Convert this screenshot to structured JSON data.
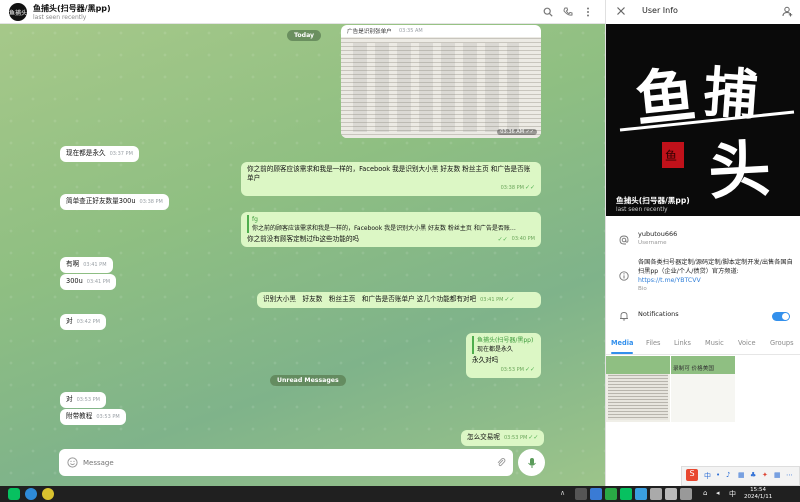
{
  "chat": {
    "title": "鱼捕头(扫号器/黑pp)",
    "status": "last seen recently",
    "avatar_text": "鱼捕头",
    "day_pill": "Today",
    "unread_pill": "Unread Messages",
    "photo_caption": "广告是识别张单户",
    "photo_time_top": "03:35 AM",
    "photo_time": "03:36 AM",
    "messages": [
      {
        "text": "现在都是永久",
        "time": "03:37 PM"
      },
      {
        "text": "你之前的顾客应该需求和我是一样的，Facebook 我是识别大小黑 好友数 粉丝主页 和广告是否账单户",
        "time": "03:38 PM"
      },
      {
        "text": "简单查正好友数量300u",
        "time": "03:38 PM"
      },
      {
        "reply_name": "fg",
        "reply_text": "你之前的顾客应该需求和我是一样的，Facebook 我是识别大小黑 好友数 粉丝主页 和广告是否账…",
        "text": "你之前没有顾客定制过fb这些功能的吗",
        "time": "03:40 PM"
      },
      {
        "text": "有啊",
        "time": "03:41 PM"
      },
      {
        "text": "300u",
        "time": "03:41 PM"
      },
      {
        "text": "识别大小黑　好友数　粉丝主页　和广告是否账单户 这几个功能都有对吧",
        "time": "03:41 PM"
      },
      {
        "text": "对",
        "time": "03:42 PM"
      },
      {
        "reply_name": "鱼捕头(扫号器/黑pp)",
        "reply_text": "现在都是永久",
        "text": "永久对吗",
        "time": "03:53 PM"
      },
      {
        "text": "对",
        "time": "03:53 PM"
      },
      {
        "text": "附带教程",
        "time": "03:53 PM"
      },
      {
        "text": "怎么交易呢",
        "time": "03:53 PM"
      }
    ],
    "composer_placeholder": "Message"
  },
  "panel": {
    "title": "User Info",
    "cover_name": "鱼捕头(扫号器/黑pp)",
    "cover_status": "last seen recently",
    "cover_logo_text": "鱼捕头",
    "username": "yubutou666",
    "username_label": "Username",
    "bio": "各国各类扫号器定制/源码定制/脚本定制开发/出售各国自扫黑pp（企业/个人/债贷）官方频道:",
    "bio_link": "https://t.me/YBTCVV",
    "bio_label": "Bio",
    "notifications_label": "Notifications",
    "tabs": [
      "Media",
      "Files",
      "Links",
      "Music",
      "Voice",
      "Groups"
    ],
    "thumb2_text": "录制可 价格美国"
  },
  "taskbar": {
    "time": "15:54",
    "date": "2024/1/11"
  },
  "colors": {
    "accent": "#3390ec",
    "outgoing_bubble": "#dcf7c5",
    "chat_bg": "#8fbf82"
  }
}
